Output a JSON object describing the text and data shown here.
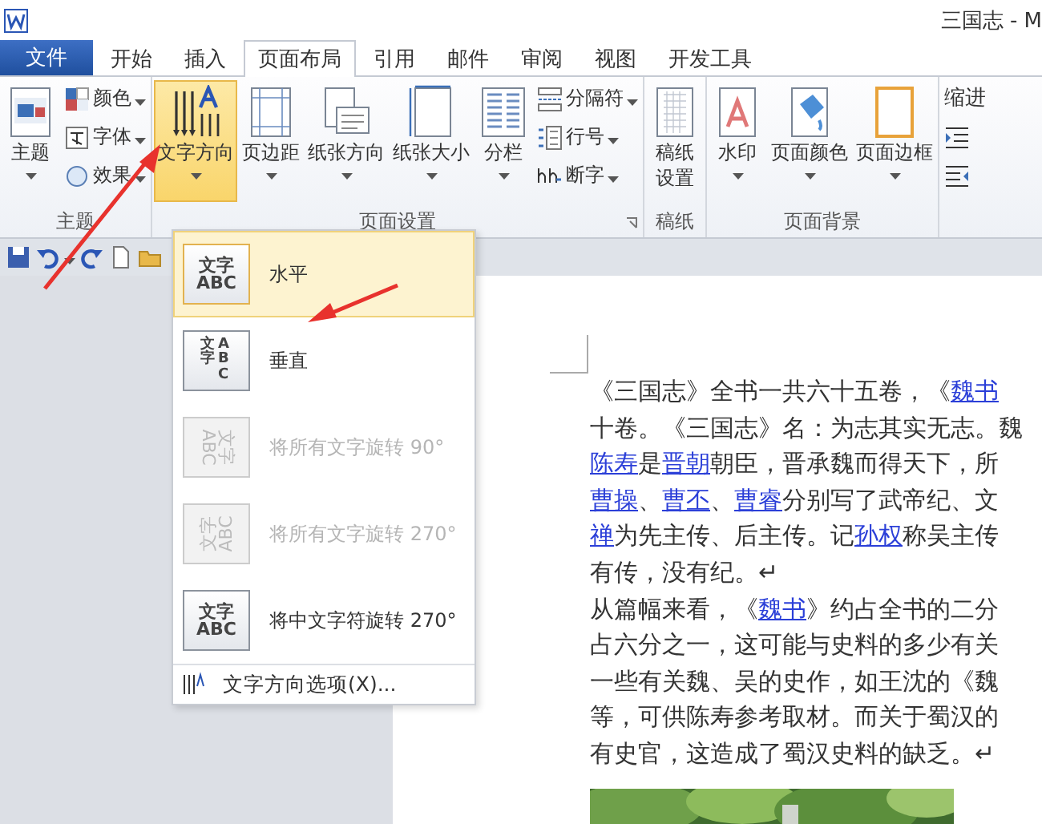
{
  "window": {
    "title": "三国志 - M"
  },
  "file_tab": {
    "label": "文件"
  },
  "tabs": [
    {
      "label": "开始",
      "selected": false
    },
    {
      "label": "插入",
      "selected": false
    },
    {
      "label": "页面布局",
      "selected": true
    },
    {
      "label": "引用",
      "selected": false
    },
    {
      "label": "邮件",
      "selected": false
    },
    {
      "label": "审阅",
      "selected": false
    },
    {
      "label": "视图",
      "selected": false
    },
    {
      "label": "开发工具",
      "selected": false
    }
  ],
  "ribbon": {
    "groups": [
      {
        "label": "主题",
        "items": [
          {
            "kind": "large",
            "label": "主题",
            "expanded": false
          },
          {
            "kind": "small",
            "label": "颜色"
          },
          {
            "kind": "small",
            "label": "字体"
          },
          {
            "kind": "small",
            "label": "效果"
          }
        ]
      },
      {
        "label": "页面设置",
        "launcher": true,
        "items": [
          {
            "kind": "large",
            "label": "文字方向",
            "expanded": true
          },
          {
            "kind": "large",
            "label": "页边距",
            "expanded": false
          },
          {
            "kind": "large",
            "label": "纸张方向",
            "expanded": false
          },
          {
            "kind": "large",
            "label": "纸张大小",
            "expanded": false
          },
          {
            "kind": "large",
            "label": "分栏",
            "expanded": false
          },
          {
            "kind": "small",
            "label": "分隔符"
          },
          {
            "kind": "small",
            "label": "行号"
          },
          {
            "kind": "small",
            "label": "断字"
          }
        ]
      },
      {
        "label": "稿纸",
        "items": [
          {
            "kind": "tall",
            "label": "稿纸设置",
            "expanded": false
          }
        ]
      },
      {
        "label": "页面背景",
        "items": [
          {
            "kind": "large",
            "label": "水印",
            "expanded": false
          },
          {
            "kind": "large",
            "label": "页面颜色",
            "expanded": false
          },
          {
            "kind": "large",
            "label": "页面边框",
            "expanded": false
          }
        ]
      }
    ],
    "cut_group": {
      "label": "缩进"
    }
  },
  "menu": {
    "items": [
      {
        "kind": "horizontal",
        "icon_text": [
          "文字",
          "ABC"
        ],
        "label": "水平",
        "disabled": false,
        "selected": true
      },
      {
        "kind": "vertical",
        "icon_text": [
          "文字",
          "ABC"
        ],
        "label": "垂直",
        "disabled": false,
        "selected": false
      },
      {
        "kind": "rotate90",
        "icon_text": [
          "文字",
          "ABC"
        ],
        "label": "将所有文字旋转 90°",
        "disabled": true,
        "selected": false
      },
      {
        "kind": "rotate270",
        "icon_text": [
          "文字",
          "ABC"
        ],
        "label": "将所有文字旋转 270°",
        "disabled": true,
        "selected": false
      },
      {
        "kind": "stacked",
        "icon_text": [
          "文字",
          "ABC"
        ],
        "label": "将中文字符旋转 270°",
        "disabled": false,
        "selected": false
      }
    ],
    "footer": {
      "label": "文字方向选项(X)..."
    }
  },
  "document": {
    "lines": [
      [
        {
          "text": "《三国志》全书一共六十五卷，《",
          "link": false
        },
        {
          "text": "魏书",
          "link": true
        }
      ],
      [
        {
          "text": "十卷。《三国志》名：为志其实无志。魏",
          "link": false
        }
      ],
      [
        {
          "text": "陈寿",
          "link": true
        },
        {
          "text": "是",
          "link": false
        },
        {
          "text": "晋朝",
          "link": true
        },
        {
          "text": "朝臣，晋承魏而得天下，所",
          "link": false
        }
      ],
      [
        {
          "text": "曹操",
          "link": true
        },
        {
          "text": "、",
          "link": false
        },
        {
          "text": "曹丕",
          "link": true
        },
        {
          "text": "、",
          "link": false
        },
        {
          "text": "曹睿",
          "link": true
        },
        {
          "text": "分别写了武帝纪、文",
          "link": false
        }
      ],
      [
        {
          "text": "禅",
          "link": true
        },
        {
          "text": "为先主传、后主传。记",
          "link": false
        },
        {
          "text": "孙权",
          "link": true
        },
        {
          "text": "称吴主传",
          "link": false
        }
      ],
      [
        {
          "text": "有传，没有纪。↵",
          "link": false
        }
      ],
      [
        {
          "text": "从篇幅来看，《",
          "link": false
        },
        {
          "text": "魏书",
          "link": true
        },
        {
          "text": "》约占全书的二分",
          "link": false
        }
      ],
      [
        {
          "text": "占六分之一，这可能与史料的多少有关",
          "link": false
        }
      ],
      [
        {
          "text": "一些有关魏、吴的史作，如王沈的《魏",
          "link": false
        }
      ],
      [
        {
          "text": "等，可供陈寿参考取材。而关于蜀汉的",
          "link": false
        }
      ],
      [
        {
          "text": "有史官，这造成了蜀汉史料的缺乏。↵",
          "link": false
        }
      ]
    ],
    "picture": {
      "kind": "picture"
    }
  }
}
